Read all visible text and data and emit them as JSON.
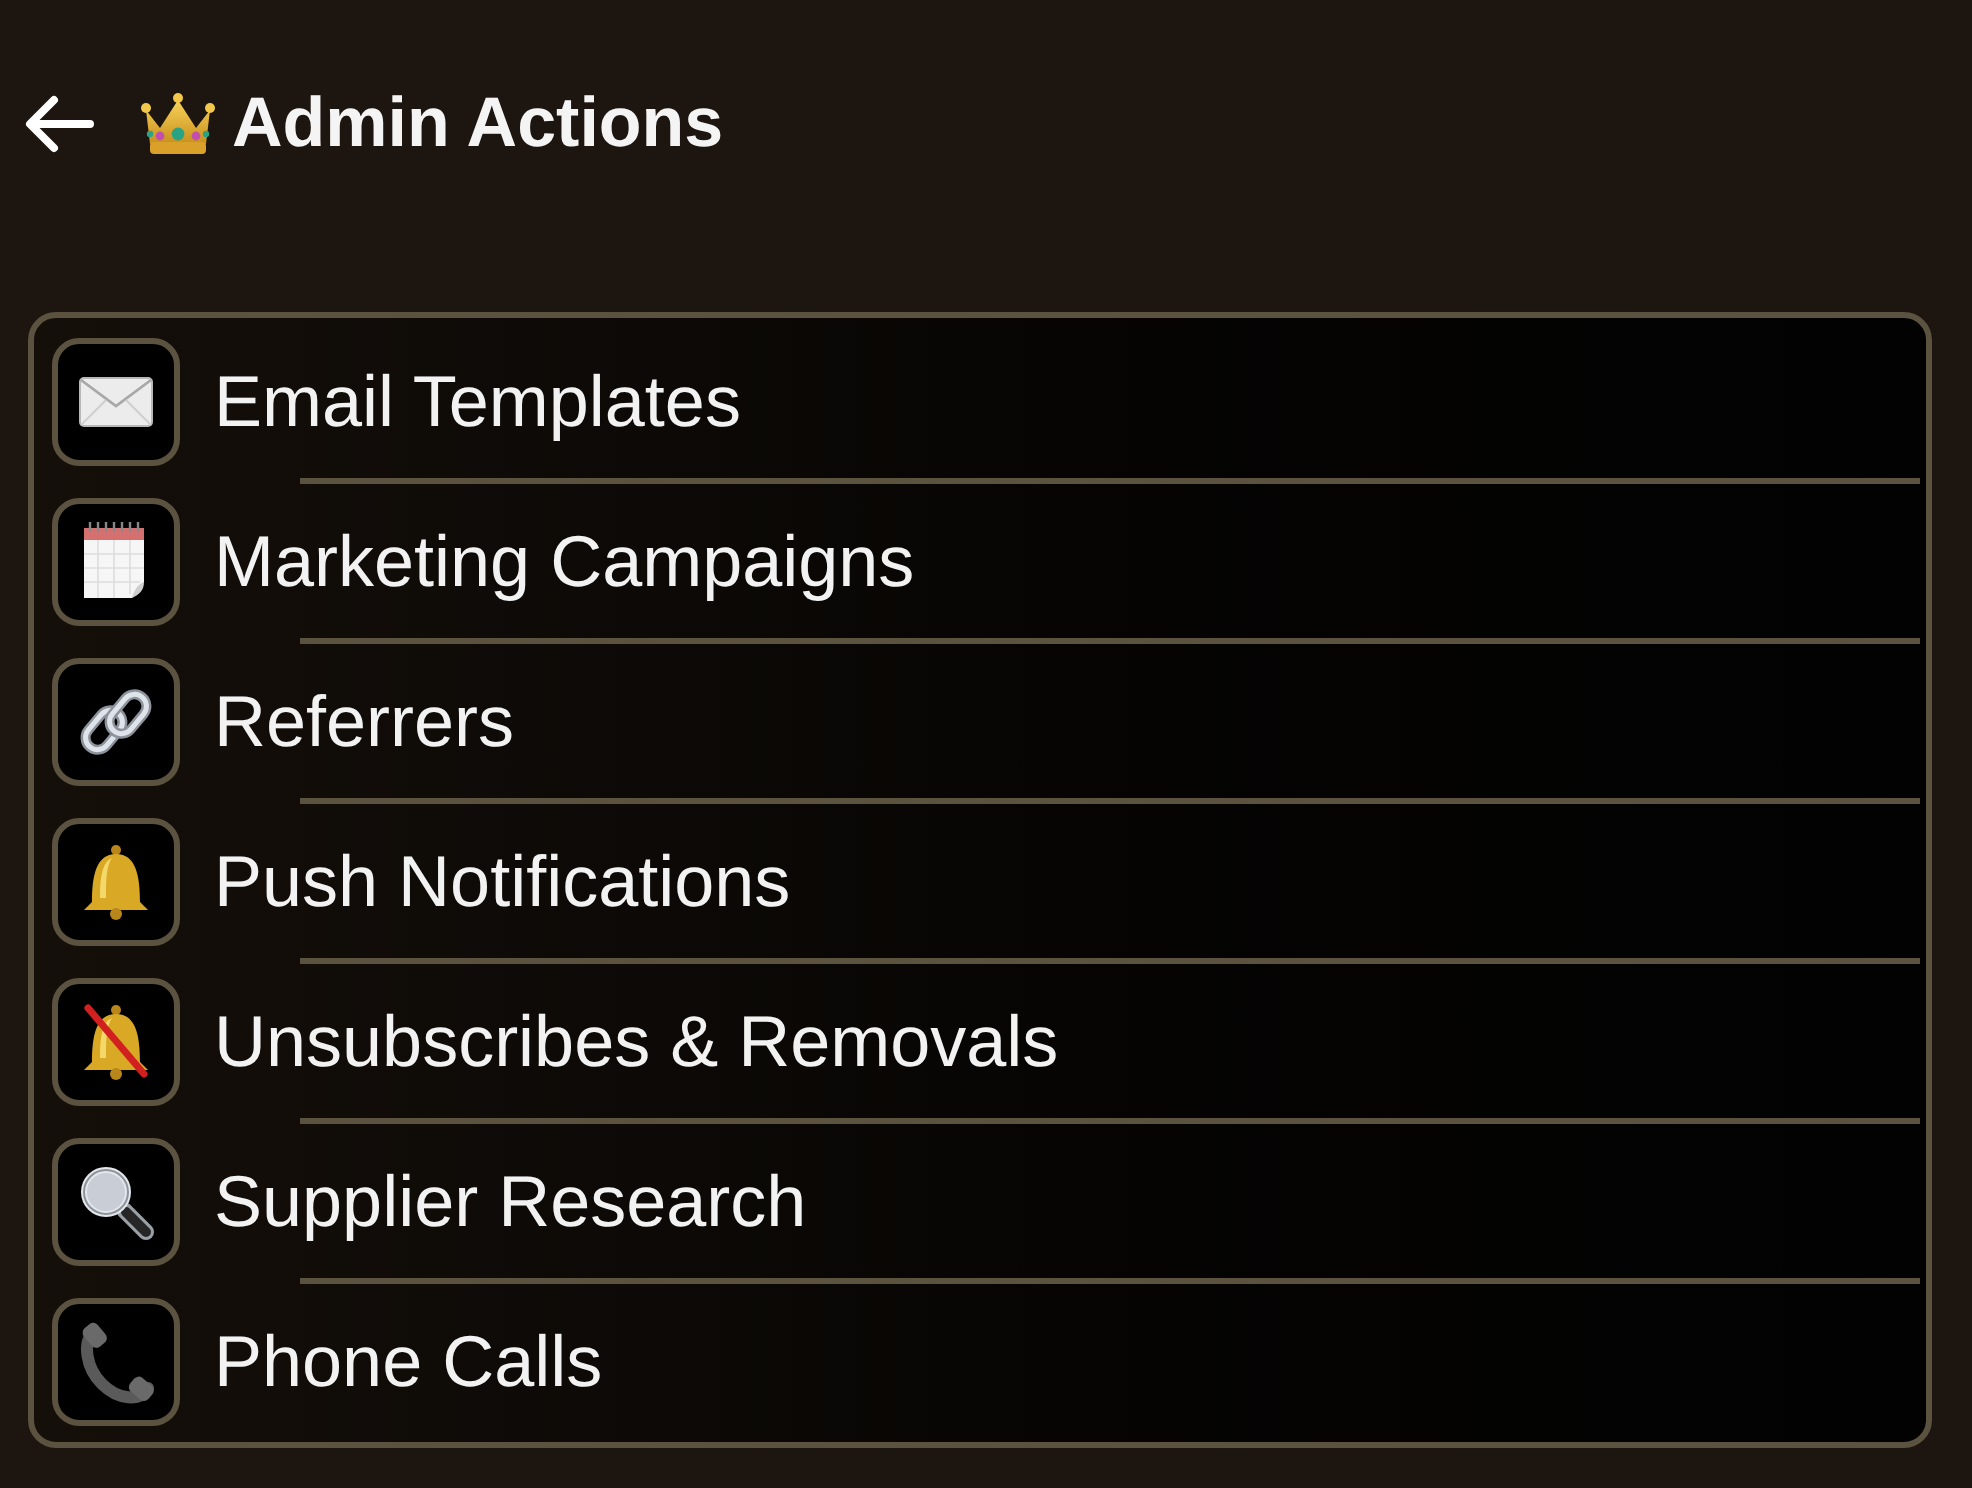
{
  "header": {
    "title": "Admin Actions"
  },
  "menu": [
    {
      "label": "Email Templates",
      "kind": "envelope"
    },
    {
      "label": "Marketing Campaigns",
      "kind": "calendar"
    },
    {
      "label": "Referrers",
      "kind": "link"
    },
    {
      "label": "Push Notifications",
      "kind": "bell"
    },
    {
      "label": "Unsubscribes & Removals",
      "kind": "mute"
    },
    {
      "label": "Supplier Research",
      "kind": "search"
    },
    {
      "label": "Phone Calls",
      "kind": "phone"
    }
  ]
}
